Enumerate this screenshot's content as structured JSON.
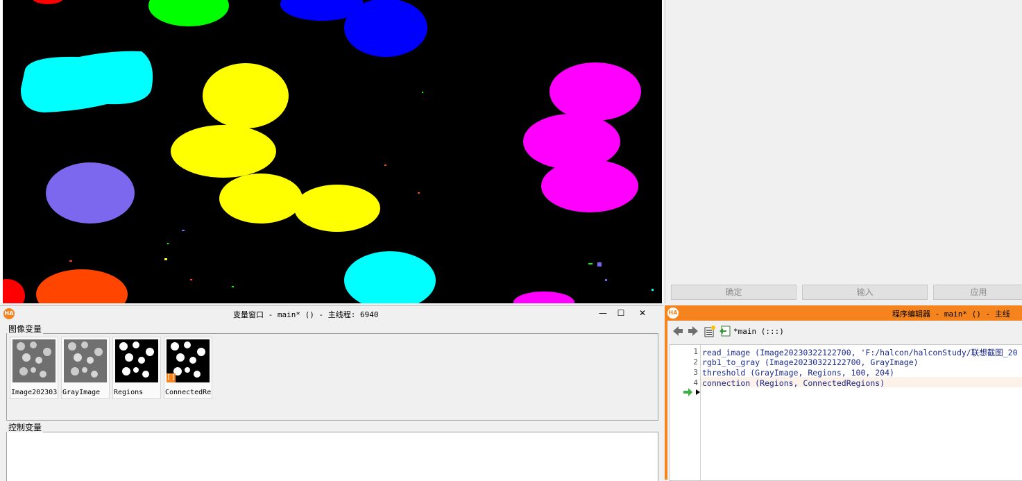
{
  "graphics_window": {
    "region_colors": [
      "#ff0000",
      "#00ff00",
      "#0000ff",
      "#00ffff",
      "#ff00ff",
      "#ffff00",
      "#7b68ee",
      "#ff4500"
    ]
  },
  "right_panel": {
    "buttons": [
      "确定",
      "输入",
      "应用"
    ]
  },
  "variable_window": {
    "title": "变量窗口 - main* () - 主线程: 6940",
    "image_vars_label": "图像变量",
    "control_vars_label": "控制变量",
    "iconic": [
      {
        "name": "Image202303",
        "kind": "photo"
      },
      {
        "name": "GrayImage",
        "kind": "photo"
      },
      {
        "name": "Regions",
        "kind": "binary"
      },
      {
        "name": "ConnectedRe",
        "kind": "binary"
      }
    ],
    "window_controls": [
      "—",
      "☐",
      "✕"
    ]
  },
  "program_editor": {
    "title": "程序编辑器 - main* () - 主线程:",
    "procedure": "*main (:::)",
    "lines": [
      {
        "num": "1",
        "code": "read_image (Image20230322122700, 'F:/halcon/halconStudy/联想截图_20"
      },
      {
        "num": "2",
        "code": "rgb1_to_gray (Image20230322122700, GrayImage)"
      },
      {
        "num": "3",
        "code": "threshold (GrayImage, Regions, 100, 204)"
      },
      {
        "num": "4",
        "code": "connection (Regions, ConnectedRegions)"
      }
    ]
  }
}
